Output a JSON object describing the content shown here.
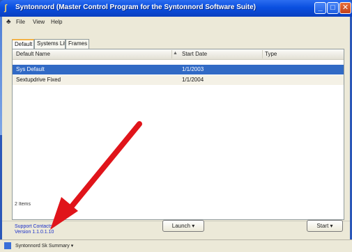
{
  "window": {
    "title": "Syntonnord (Master Control Program for the Syntonnord Software Suite)",
    "min_glyph": "_",
    "max_glyph": "□",
    "close_glyph": "✕"
  },
  "menubar": {
    "items": [
      "File",
      "View",
      "Help"
    ]
  },
  "tabs": [
    "Default",
    "Systems Lite",
    "Frames"
  ],
  "table": {
    "columns": [
      "Default Name",
      "Start Date",
      "Type"
    ],
    "sort_indicator": "▲",
    "rows": [
      {
        "name": "Sys Default",
        "date": "1/1/2003"
      },
      {
        "name": "Sextupdrive Fixed",
        "date": "1/1/2004"
      }
    ]
  },
  "items_count": "2 Items",
  "links": {
    "support": "Support Contacts",
    "version": "Version 1.1.0.1.10"
  },
  "buttons": {
    "launch": "Launch ▾",
    "start": "Start ▾"
  },
  "taskbar": {
    "text": "Syntonnord Sk Summary ▾"
  },
  "colors": {
    "titlebar": "#0a4fe0",
    "selection": "#316ac5",
    "arrow": "#e0141a"
  },
  "icons": {
    "app": "syntonnord-app-icon",
    "menu": "window-menu-icon"
  }
}
